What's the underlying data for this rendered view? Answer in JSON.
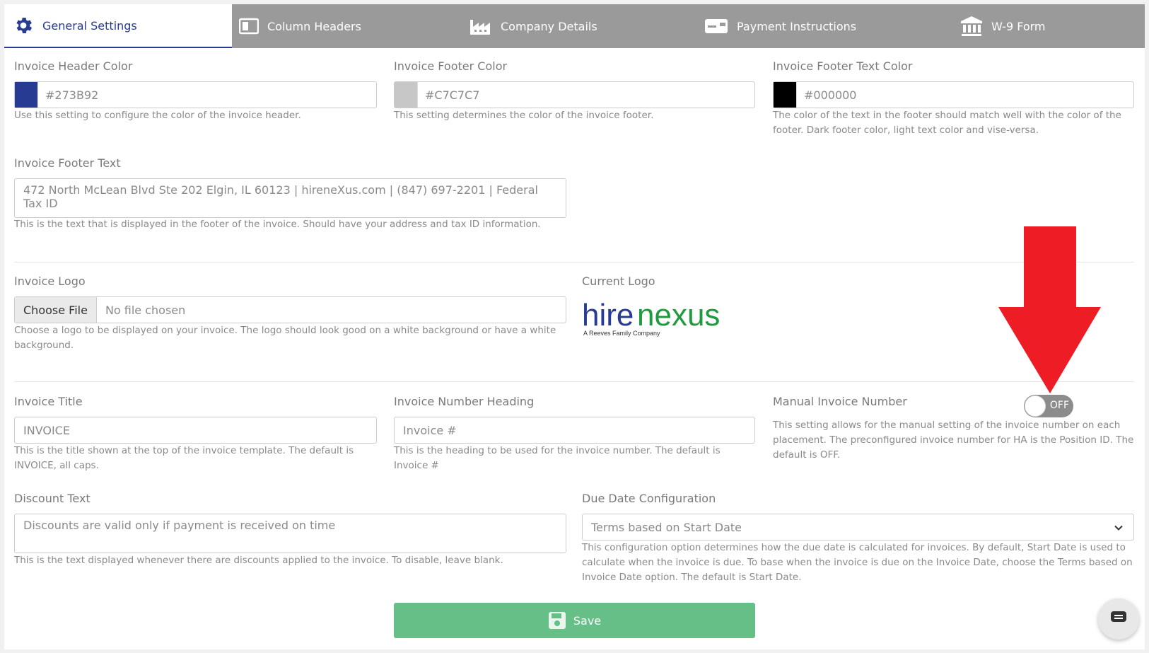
{
  "tabs": [
    {
      "label": "General Settings",
      "icon": "gear-icon"
    },
    {
      "label": "Column Headers",
      "icon": "columns-icon"
    },
    {
      "label": "Company Details",
      "icon": "factory-icon"
    },
    {
      "label": "Payment Instructions",
      "icon": "payment-card-icon"
    },
    {
      "label": "W-9 Form",
      "icon": "bank-icon"
    }
  ],
  "header_color": {
    "label": "Invoice Header Color",
    "value": "#273B92",
    "color": "#273B92",
    "help": "Use this setting to configure the color of the invoice header."
  },
  "footer_color": {
    "label": "Invoice Footer Color",
    "value": "#C7C7C7",
    "color": "#C7C7C7",
    "help": "This setting determines the color of the invoice footer."
  },
  "footer_text_color": {
    "label": "Invoice Footer Text Color",
    "value": "#000000",
    "color": "#000000",
    "help": "The color of the text in the footer should match well with the color of the footer. Dark footer color, light text color and vise-versa."
  },
  "footer_text": {
    "label": "Invoice Footer Text",
    "value": "472 North McLean Blvd Ste 202 Elgin, IL 60123 | hireneXus.com | (847) 697-2201 | Federal Tax ID",
    "help": "This is the text that is displayed in the footer of the invoice. Should have your address and tax ID information."
  },
  "logo": {
    "label": "Invoice Logo",
    "button": "Choose File",
    "file_status": "No file chosen",
    "help": "Choose a logo to be displayed on your invoice. The logo should look good on a white background or have a white background."
  },
  "current_logo": {
    "label": "Current Logo",
    "logo_text": "hirenexus",
    "logo_tagline": "A Reeves Family Company"
  },
  "title": {
    "label": "Invoice Title",
    "value": "INVOICE",
    "help": "This is the title shown at the top of the invoice template. The default is INVOICE, all caps."
  },
  "number_heading": {
    "label": "Invoice Number Heading",
    "value": "Invoice #",
    "help": "This is the heading to be used for the invoice number. The default is Invoice #"
  },
  "manual_number": {
    "label": "Manual Invoice Number",
    "toggle": "OFF",
    "help": "This setting allows for the manual setting of the invoice number on each placement. The preconfigured invoice number for HA is the Position ID. The default is OFF."
  },
  "discount": {
    "label": "Discount Text",
    "placeholder": "Discounts are valid only if payment is received on time",
    "help": "This is the text displayed whenever there are discounts applied to the invoice. To disable, leave blank."
  },
  "due_date": {
    "label": "Due Date Configuration",
    "value": "Terms based on Start Date",
    "help": "This configuration option determines how the due date is calculated for invoices. By default, Start Date is used to calculate when the invoice is due. To base when the invoice is due on the Invoice Date, choose the Terms based on Invoice Date option. The default is Start Date."
  },
  "save_label": "Save",
  "colors": {
    "accent": "#273B92",
    "tabbar": "#9a9a9a",
    "save": "#66bf86",
    "arrow": "#ee1c25"
  }
}
